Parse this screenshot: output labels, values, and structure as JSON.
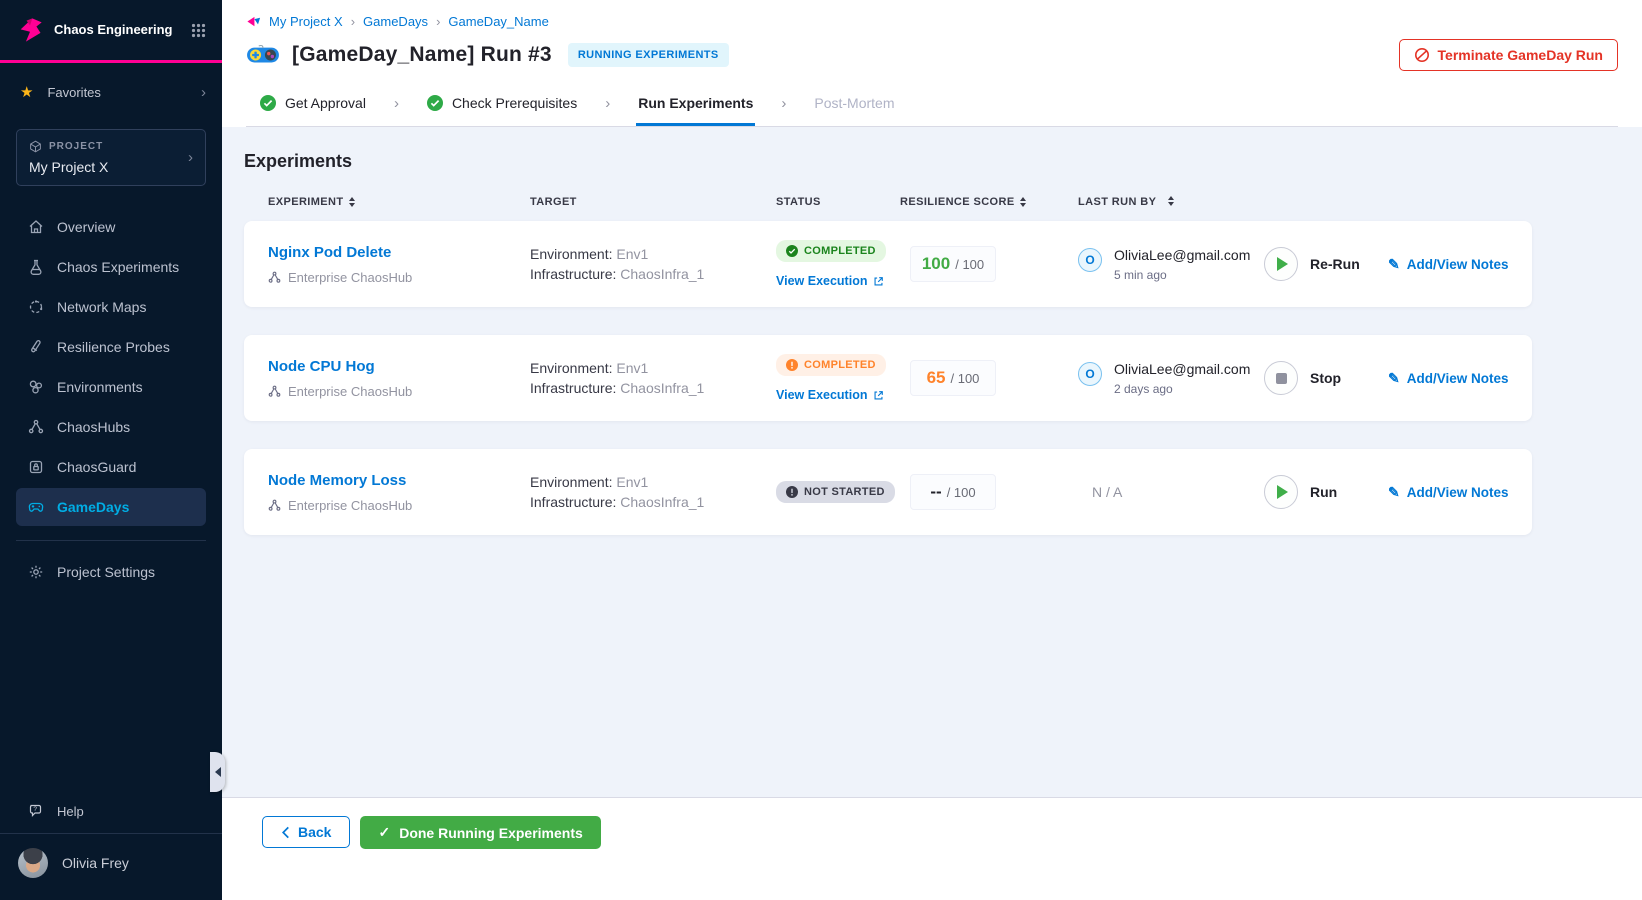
{
  "sidebar": {
    "brand_title": "Chaos Engineering",
    "favorites_label": "Favorites",
    "project": {
      "label": "PROJECT",
      "name": "My Project X"
    },
    "nav": [
      {
        "label": "Overview"
      },
      {
        "label": "Chaos Experiments"
      },
      {
        "label": "Network Maps"
      },
      {
        "label": "Resilience Probes"
      },
      {
        "label": "Environments"
      },
      {
        "label": "ChaosHubs"
      },
      {
        "label": "ChaosGuard"
      },
      {
        "label": "GameDays"
      }
    ],
    "settings_label": "Project Settings",
    "help_label": "Help",
    "user_name": "Olivia Frey"
  },
  "header": {
    "breadcrumb": [
      "My Project X",
      "GameDays",
      "GameDay_Name"
    ],
    "title": "[GameDay_Name] Run #3",
    "status_badge": "RUNNING EXPERIMENTS",
    "terminate_button": "Terminate GameDay Run"
  },
  "stepper": {
    "steps": [
      {
        "label": "Get Approval",
        "state": "done"
      },
      {
        "label": "Check Prerequisites",
        "state": "done"
      },
      {
        "label": "Run Experiments",
        "state": "active"
      },
      {
        "label": "Post-Mortem",
        "state": "upcoming"
      }
    ]
  },
  "experiments": {
    "heading": "Experiments",
    "columns": [
      {
        "label": "EXPERIMENT",
        "sortable": true
      },
      {
        "label": "TARGET",
        "sortable": false
      },
      {
        "label": "STATUS",
        "sortable": false
      },
      {
        "label": "RESILIENCE SCORE",
        "sortable": true
      },
      {
        "label": "LAST RUN BY",
        "sortable": true
      }
    ],
    "labels": {
      "environment": "Environment:",
      "infrastructure": "Infrastructure:",
      "view_execution": "View Execution",
      "notes": "Add/View Notes",
      "score_max": "/ 100"
    },
    "rows": [
      {
        "name": "Nginx Pod Delete",
        "hub": "Enterprise ChaosHub",
        "environment": "Env1",
        "infrastructure": "ChaosInfra_1",
        "status": "COMPLETED",
        "score": "100",
        "run_by_initial": "O",
        "run_by": "OliviaLee@gmail.com",
        "run_time": "5 min ago",
        "action": "Re-Run"
      },
      {
        "name": "Node CPU Hog",
        "hub": "Enterprise ChaosHub",
        "environment": "Env1",
        "infrastructure": "ChaosInfra_1",
        "status": "COMPLETED",
        "score": "65",
        "run_by_initial": "O",
        "run_by": "OliviaLee@gmail.com",
        "run_time": "2 days ago",
        "action": "Stop"
      },
      {
        "name": "Node Memory Loss",
        "hub": "Enterprise ChaosHub",
        "environment": "Env1",
        "infrastructure": "ChaosInfra_1",
        "status": "NOT STARTED",
        "score": "--",
        "last_run": "N / A",
        "action": "Run"
      }
    ]
  },
  "footer": {
    "back": "Back",
    "done": "Done Running Experiments"
  },
  "colors": {
    "accent_blue": "#0278d5",
    "sidebar_bg": "#07182b",
    "brand_pink": "#ff0094",
    "selected_cyan": "#00ade4",
    "success_green": "#1b841d",
    "warn_orange": "#ff832b",
    "danger_red": "#e43326",
    "done_green": "#42ab45"
  }
}
